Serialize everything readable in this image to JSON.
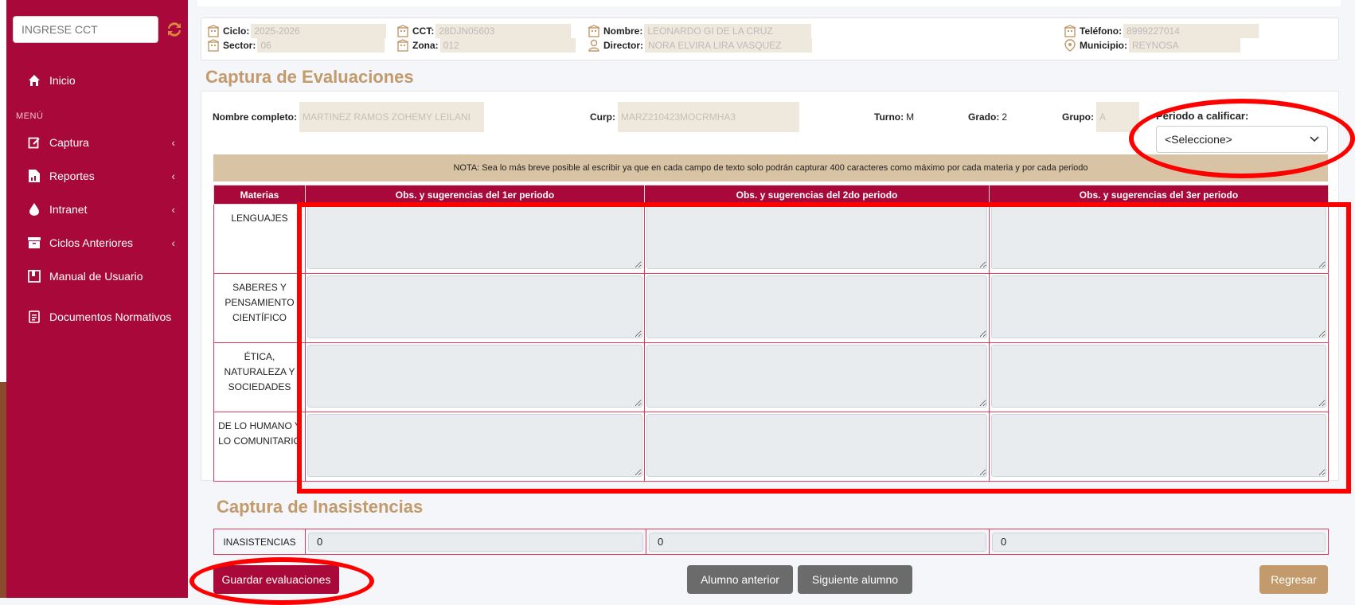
{
  "sidebar": {
    "cct_placeholder": "INGRESE CCT",
    "section_label": "MENÚ",
    "items": [
      {
        "label": "Inicio",
        "icon": "home-icon"
      },
      {
        "label": "Captura",
        "icon": "edit-icon"
      },
      {
        "label": "Reportes",
        "icon": "report-icon"
      },
      {
        "label": "Intranet",
        "icon": "drop-icon"
      },
      {
        "label": "Ciclos Anteriores",
        "icon": "archive-icon"
      },
      {
        "label": "Manual de Usuario",
        "icon": "book-icon"
      },
      {
        "label": "Documentos Normativos",
        "icon": "document-icon"
      }
    ],
    "color": "#a8093a"
  },
  "info": {
    "ciclo_label": "Ciclo:",
    "ciclo": "2025-2026",
    "sector_label": "Sector:",
    "sector": "06",
    "cct_label": "CCT:",
    "cct": "28DJN05603",
    "zona_label": "Zona:",
    "zona": "012",
    "nombre_label": "Nombre:",
    "nombre": "LEONARDO GI DE LA CRUZ",
    "director_label": "Director:",
    "director": "NORA ELVIRA LIRA VASQUEZ",
    "telefono_label": "Teléfono:",
    "telefono": "8999227014",
    "municipio_label": "Municipio:",
    "municipio": "REYNOSA"
  },
  "evaluaciones": {
    "title": "Captura de Evaluaciones",
    "nombre_label": "Nombre completo:",
    "nombre": "MARTINEZ RAMOS ZOHEMY LEILANI",
    "curp_label": "Curp:",
    "curp": "MARZ210423MOCRMHA3",
    "turno_label": "Turno:",
    "turno": "M",
    "grado_label": "Grado:",
    "grado": "2",
    "grupo_label": "Grupo:",
    "grupo": "A",
    "periodo_label": "Periodo a calificar:",
    "periodo_selected": "<Seleccione>",
    "nota": "NOTA: Sea lo más breve posible al escribir ya que en cada campo de texto solo podrán capturar 400 caracteres como máximo por cada materia y por cada periodo",
    "headers": [
      "Materias",
      "Obs. y sugerencias del 1er periodo",
      "Obs. y sugerencias del 2do periodo",
      "Obs. y sugerencias del 3er periodo"
    ],
    "materias": [
      "LENGUAJES",
      "SABERES Y PENSAMIENTO CIENTÍFICO",
      "ÉTICA, NATURALEZA Y SOCIEDADES",
      "DE LO HUMANO Y LO COMUNITARIO"
    ]
  },
  "inasistencias": {
    "title": "Captura de Inasistencias",
    "label": "INASISTENCIAS",
    "values": [
      "0",
      "0",
      "0"
    ]
  },
  "buttons": {
    "save": "Guardar evaluaciones",
    "prev": "Alumno anterior",
    "next": "Siguiente alumno",
    "back": "Regresar"
  },
  "colors": {
    "primary": "#a8093a",
    "accent": "#c29a6b",
    "nota_bg": "#d8c3a5",
    "annotation": "#ff0000"
  }
}
